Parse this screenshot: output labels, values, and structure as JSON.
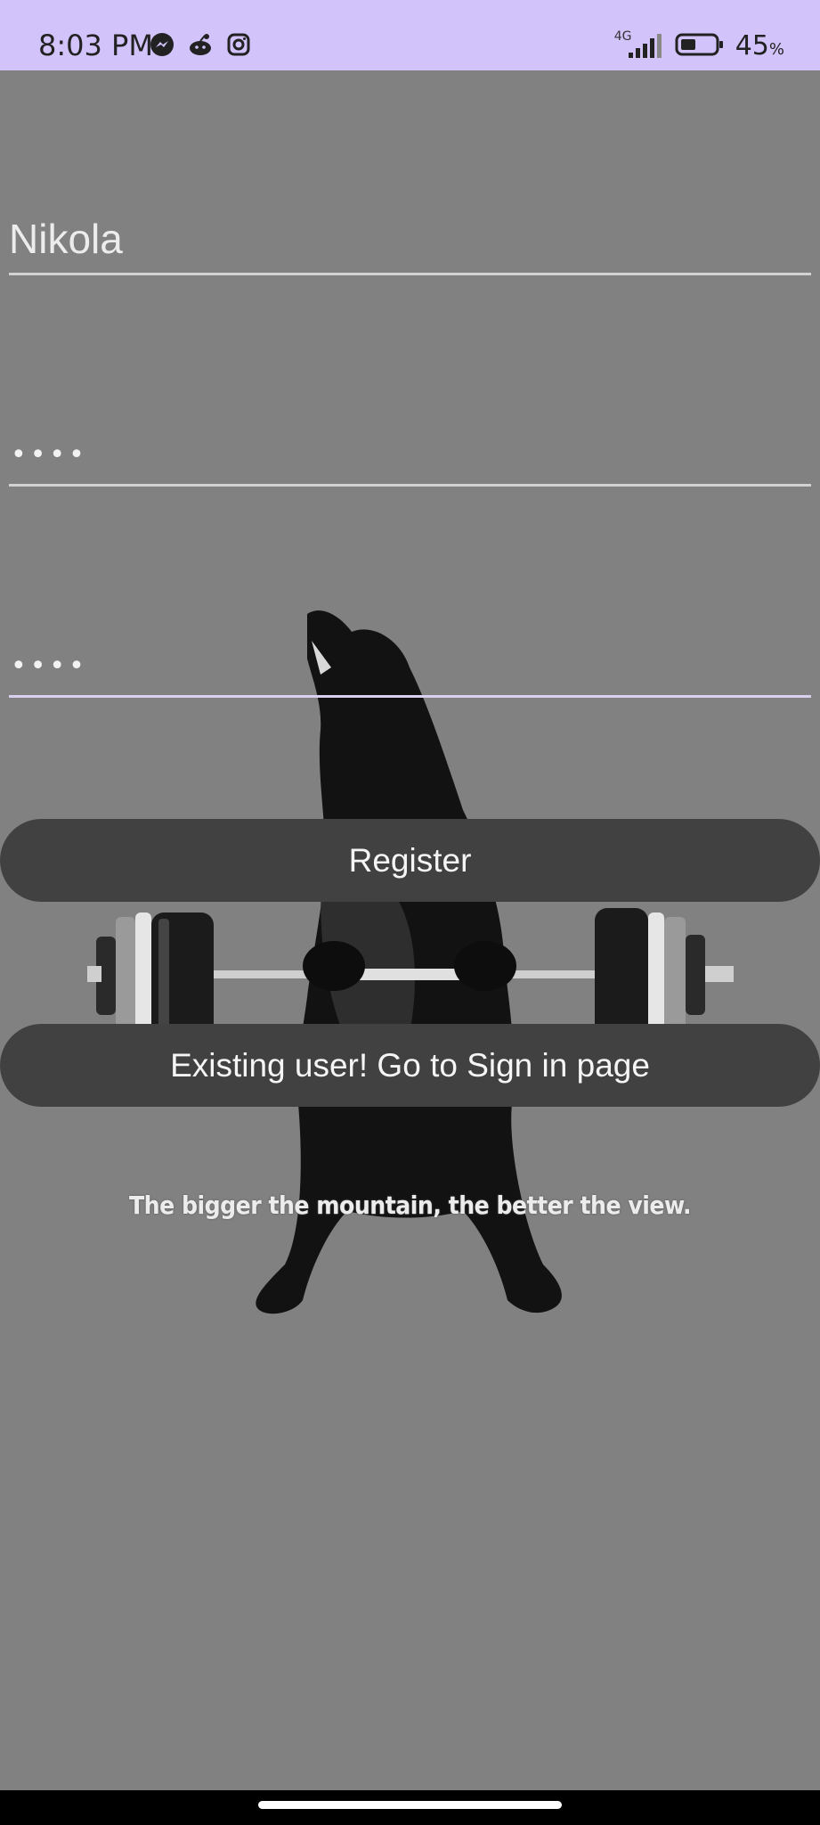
{
  "status_bar": {
    "time": "8:03 PM",
    "network": "4G",
    "battery_percent": "45",
    "battery_unit": "%",
    "battery_level": 0.45,
    "icons": [
      "messenger-icon",
      "reddit-icon",
      "instagram-icon",
      "signal-icon",
      "battery-icon"
    ]
  },
  "form": {
    "name_value": "Nikola",
    "password_mask": "••••",
    "confirm_mask": "••••"
  },
  "buttons": {
    "register_label": "Register",
    "signin_label": "Existing user! Go to Sign in page"
  },
  "motivation_text": "The bigger the mountain, the better the view.",
  "colors": {
    "status_bar_bg": "#d3c3fb",
    "app_bg": "#818181",
    "button_bg": "#414141",
    "button_text": "#f5f5f5"
  }
}
